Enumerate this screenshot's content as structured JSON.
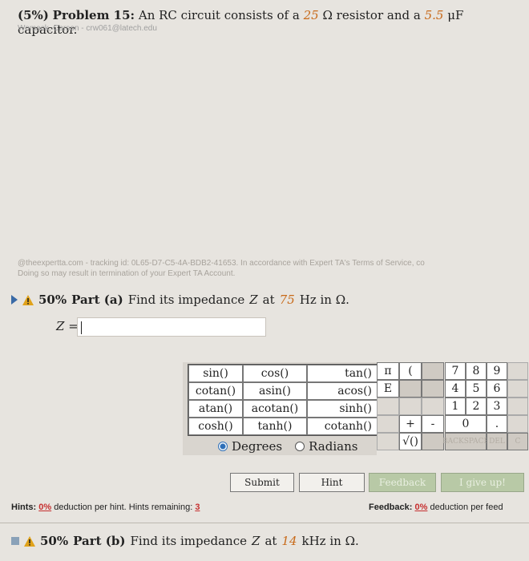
{
  "problem": {
    "weight": "(5%)",
    "label": "Problem 15:",
    "text_before": "An RC circuit consists of a",
    "resistance_value": "25",
    "resistance_unit": "Ω",
    "text_middle": "resistor and a",
    "capacitance_value": "5.5",
    "capacitance_unit": "μF",
    "text_after": "capacitor.",
    "author": "Womack, Carson - crw061@latech.edu"
  },
  "watermark": {
    "line1": "@theexpertta.com - tracking id: 0L65-D7-C5-4A-BDB2-41653. In accordance with Expert TA's Terms of Service, co",
    "line2": "Doing so may result in termination of your Expert TA Account."
  },
  "part_a": {
    "percent": "50%",
    "label": "Part (a)",
    "text": "Find its impedance",
    "var": "Z",
    "at": "at",
    "freq_value": "75",
    "freq_unit": "Hz in Ω."
  },
  "answer": {
    "label": "Z =",
    "value": ""
  },
  "functions": [
    "sin()",
    "cos()",
    "tan()",
    "cotan()",
    "asin()",
    "acos()",
    "atan()",
    "acotan()",
    "sinh()",
    "cosh()",
    "tanh()",
    "cotanh()"
  ],
  "modes": {
    "degrees": "Degrees",
    "radians": "Radians",
    "selected": "Degrees"
  },
  "symbols": [
    "π",
    "(",
    "",
    "E",
    "",
    "",
    "",
    "",
    "",
    "",
    "+",
    "-",
    "",
    "√()",
    ""
  ],
  "keypad": {
    "row1": [
      "7",
      "8",
      "9"
    ],
    "row2": [
      "4",
      "5",
      "6"
    ],
    "row3": [
      "1",
      "2",
      "3"
    ],
    "row4": [
      "0",
      "."
    ],
    "backspace": "BACKSPACE",
    "del": "DEL",
    "clear": "C"
  },
  "buttons": {
    "submit": "Submit",
    "hint": "Hint",
    "feedback": "Feedback",
    "give_up": "I give up!"
  },
  "hints": {
    "label": "Hints:",
    "deduction": "0%",
    "deduction_text": "deduction per hint. Hints remaining:",
    "remaining": "3"
  },
  "feedback": {
    "label": "Feedback:",
    "deduction": "0%",
    "deduction_text": "deduction per feed"
  },
  "part_b": {
    "percent": "50%",
    "label": "Part (b)",
    "text": "Find its impedance",
    "var": "Z",
    "at": "at",
    "freq_value": "14",
    "freq_unit": "kHz in Ω."
  },
  "colors": {
    "background": "#e7e4df",
    "highlight": "#c86a1a",
    "hint_value": "#c62f2f",
    "radio_selected": "#2d6fb8",
    "warning": "#e0a21a",
    "play_arrow": "#3a6aa6"
  }
}
